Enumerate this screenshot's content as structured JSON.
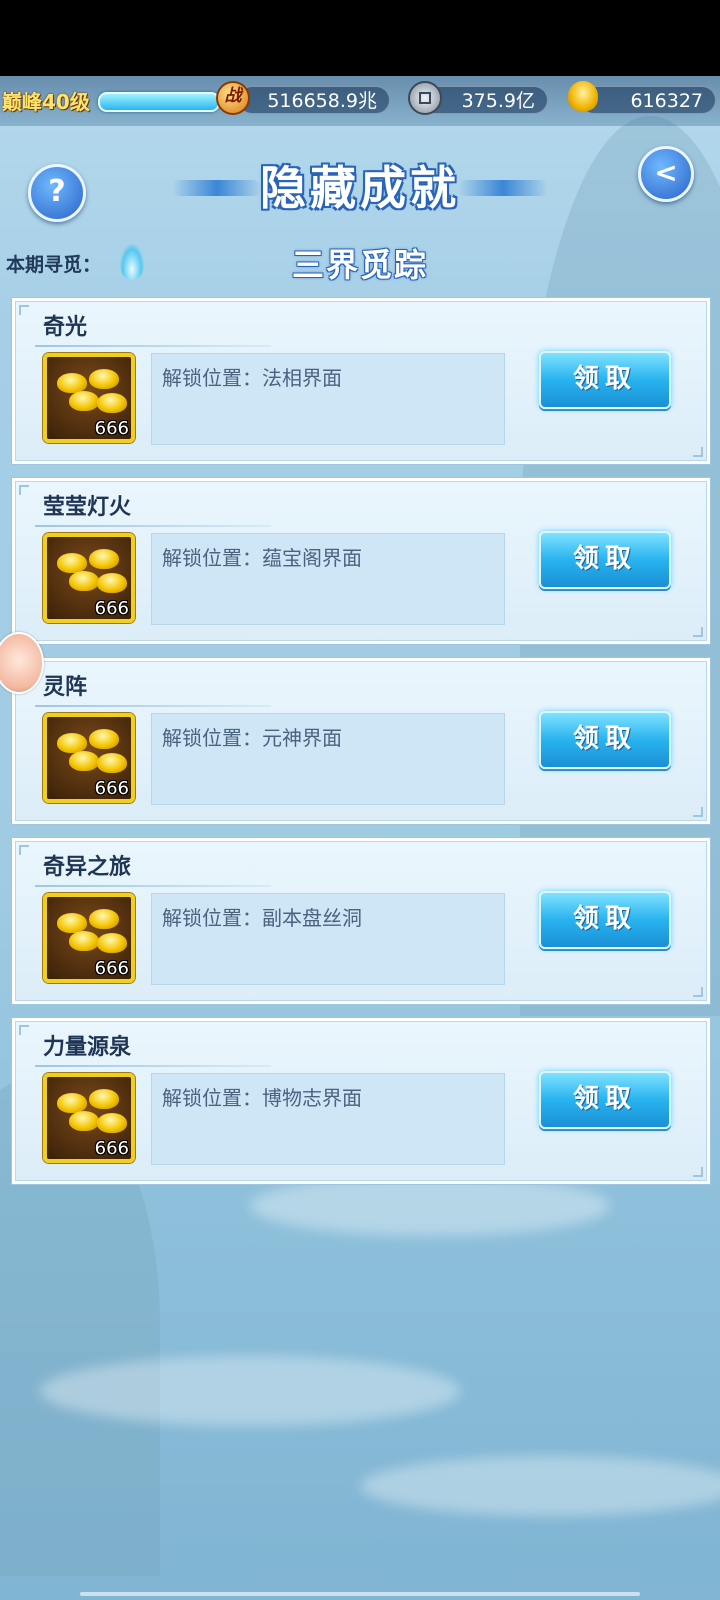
{
  "topbar": {
    "level": "巅峰40级",
    "combat_icon": "战",
    "combat_power": "516658.9兆",
    "silver": "375.9亿",
    "gold": "616327"
  },
  "header": {
    "title": "隐藏成就",
    "period_label": "本期寻觅：",
    "subtitle": "三界觅踪"
  },
  "achievements": [
    {
      "name": "奇光",
      "reward_count": "666",
      "unlock": "解锁位置：法相界面",
      "button": "领取"
    },
    {
      "name": "莹莹灯火",
      "reward_count": "666",
      "unlock": "解锁位置：蕴宝阁界面",
      "button": "领取"
    },
    {
      "name": "灵阵",
      "reward_count": "666",
      "unlock": "解锁位置：元神界面",
      "button": "领取"
    },
    {
      "name": "奇异之旅",
      "reward_count": "666",
      "unlock": "解锁位置：副本盘丝洞",
      "button": "领取"
    },
    {
      "name": "力量源泉",
      "reward_count": "666",
      "unlock": "解锁位置：博物志界面",
      "button": "领取"
    }
  ],
  "icons": {
    "help": "?",
    "back": "<"
  },
  "colors": {
    "accent": "#28b3ee",
    "title_outline": "#2a64b8",
    "reward_border": "#f0cf20"
  }
}
